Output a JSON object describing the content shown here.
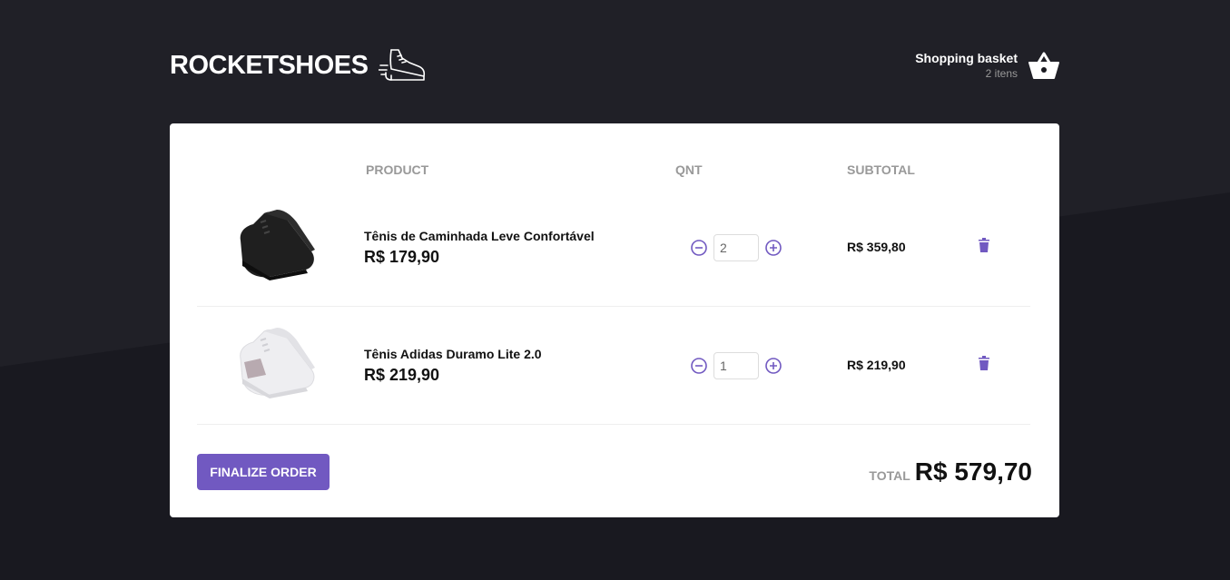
{
  "header": {
    "logo_text": "ROCKETSHOES",
    "basket_title": "Shopping basket",
    "basket_count": "2 itens"
  },
  "cart": {
    "columns": {
      "product": "PRODUCT",
      "qnt": "QNT",
      "subtotal": "SUBTOTAL"
    },
    "items": [
      {
        "title": "Tênis de Caminhada Leve Confortável",
        "price": "R$ 179,90",
        "quantity": "2",
        "subtotal": "R$ 359,80",
        "shoe_color": "#1f1f1f"
      },
      {
        "title": "Tênis Adidas Duramo Lite 2.0",
        "price": "R$ 219,90",
        "quantity": "1",
        "subtotal": "R$ 219,90",
        "shoe_color": "#f2f2f4"
      }
    ]
  },
  "footer": {
    "finalize_label": "FINALIZE ORDER",
    "total_label": "TOTAL",
    "total_value": "R$ 579,70"
  },
  "colors": {
    "accent": "#7159c1",
    "background": "#191920"
  },
  "icons": {
    "logo": "running-shoe-icon",
    "basket": "shopping-basket-icon",
    "decrement": "remove-circle-icon",
    "increment": "add-circle-icon",
    "delete": "trash-icon"
  }
}
